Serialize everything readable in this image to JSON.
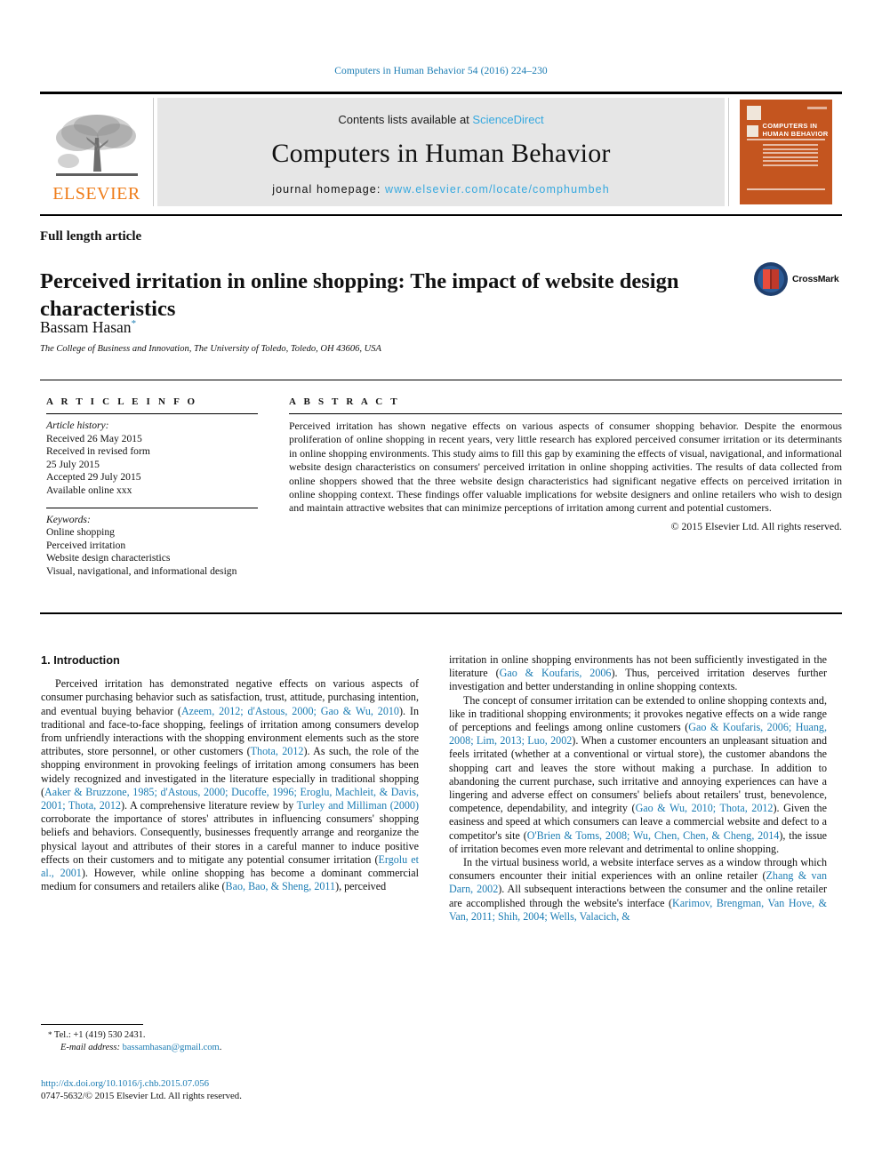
{
  "running_head": "Computers in Human Behavior 54 (2016) 224–230",
  "masthead": {
    "contents_prefix": "Contents lists available at ",
    "sciencedirect": "ScienceDirect",
    "journal_title": "Computers in Human Behavior",
    "homepage_label": "journal homepage:",
    "homepage_url": "www.elsevier.com/locate/comphumbeh",
    "publisher_wordmark": "ELSEVIER",
    "cover_title_line1": "COMPUTERS IN",
    "cover_title_line2": "HUMAN BEHAVIOR",
    "accent_blue": "#35a8df",
    "elsevier_orange": "#ef7d1a",
    "cover_orange": "#c4551f",
    "band_gray": "#e6e6e6"
  },
  "article": {
    "type": "Full length article",
    "title": "Perceived irritation in online shopping: The impact of website design characteristics",
    "author": "Bassam Hasan",
    "author_mark": "*",
    "affiliation": "The College of Business and Innovation, The University of Toledo, Toledo, OH 43606, USA",
    "crossmark_label": "CrossMark"
  },
  "article_info": {
    "heading": "A R T I C L E  I N F O",
    "history_label": "Article history:",
    "history": [
      "Received 26 May 2015",
      "Received in revised form",
      "25 July 2015",
      "Accepted 29 July 2015",
      "Available online xxx"
    ],
    "keywords_label": "Keywords:",
    "keywords": [
      "Online shopping",
      "Perceived irritation",
      "Website design characteristics",
      "Visual, navigational, and informational design"
    ]
  },
  "abstract": {
    "heading": "A B S T R A C T",
    "text": "Perceived irritation has shown negative effects on various aspects of consumer shopping behavior. Despite the enormous proliferation of online shopping in recent years, very little research has explored perceived consumer irritation or its determinants in online shopping environments. This study aims to fill this gap by examining the effects of visual, navigational, and informational website design characteristics on consumers' perceived irritation in online shopping activities. The results of data collected from online shoppers showed that the three website design characteristics had significant negative effects on perceived irritation in online shopping context. These findings offer valuable implications for website designers and online retailers who wish to design and maintain attractive websites that can minimize perceptions of irritation among current and potential customers.",
    "copyright": "© 2015 Elsevier Ltd. All rights reserved."
  },
  "body": {
    "section_title": "1. Introduction",
    "left_p1_a": "Perceived irritation has demonstrated negative effects on various aspects of consumer purchasing behavior such as satisfaction, trust, attitude, purchasing intention, and eventual buying behavior (",
    "left_p1_ref1": "Azeem, 2012; d'Astous, 2000; Gao & Wu, 2010",
    "left_p1_b": "). In traditional and face-to-face shopping, feelings of irritation among consumers develop from unfriendly interactions with the shopping environment elements such as the store attributes, store personnel, or other customers (",
    "left_p1_ref2": "Thota, 2012",
    "left_p1_c": "). As such, the role of the shopping environment in provoking feelings of irritation among consumers has been widely recognized and investigated in the literature especially in traditional shopping (",
    "left_p1_ref3": "Aaker & Bruzzone, 1985; d'Astous, 2000; Ducoffe, 1996; Eroglu, Machleit, & Davis, 2001; Thota, 2012",
    "left_p1_d": "). A comprehensive literature review by ",
    "left_p1_ref4": "Turley and Milliman (2000)",
    "left_p1_e": " corroborate the importance of stores' attributes in influencing consumers' shopping beliefs and behaviors. Consequently, businesses frequently arrange and reorganize the physical layout and attributes of their stores in a careful manner to induce positive effects on their customers and to mitigate any potential consumer irritation (",
    "left_p1_ref5": "Ergolu et al., 2001",
    "left_p1_f": "). However, while online shopping has become a dominant commercial medium for consumers and retailers alike (",
    "left_p1_ref6": "Bao, Bao, & Sheng, 2011",
    "left_p1_g": "), perceived",
    "right_p1_a": "irritation in online shopping environments has not been sufficiently investigated in the literature (",
    "right_p1_ref1": "Gao & Koufaris, 2006",
    "right_p1_b": "). Thus, perceived irritation deserves further investigation and better understanding in online shopping contexts.",
    "right_p2_a": "The concept of consumer irritation can be extended to online shopping contexts and, like in traditional shopping environments; it provokes negative effects on a wide range of perceptions and feelings among online customers (",
    "right_p2_ref1": "Gao & Koufaris, 2006; Huang, 2008; Lim, 2013; Luo, 2002",
    "right_p2_b": "). When a customer encounters an unpleasant situation and feels irritated (whether at a conventional or virtual store), the customer abandons the shopping cart and leaves the store without making a purchase. In addition to abandoning the current purchase, such irritative and annoying experiences can have a lingering and adverse effect on consumers' beliefs about retailers' trust, benevolence, competence, dependability, and integrity (",
    "right_p2_ref2": "Gao & Wu, 2010; Thota, 2012",
    "right_p2_c": "). Given the easiness and speed at which consumers can leave a commercial website and defect to a competitor's site (",
    "right_p2_ref3": "O'Brien & Toms, 2008; Wu, Chen, Chen, & Cheng, 2014",
    "right_p2_d": "), the issue of irritation becomes even more relevant and detrimental to online shopping.",
    "right_p3_a": "In the virtual business world, a website interface serves as a window through which consumers encounter their initial experiences with an online retailer (",
    "right_p3_ref1": "Zhang & van Darn, 2002",
    "right_p3_b": "). All subsequent interactions between the consumer and the online retailer are accomplished through the website's interface (",
    "right_p3_ref2": "Karimov, Brengman, Van Hove, & Van, 2011; Shih, 2004; Wells, Valacich, &"
  },
  "footer": {
    "tel_star": "*",
    "tel": " Tel.: +1 (419) 530 2431.",
    "email_label": "E-mail address:",
    "email": "bassamhasan@gmail.com",
    "email_trail": ".",
    "doi": "http://dx.doi.org/10.1016/j.chb.2015.07.056",
    "issn": "0747-5632/© 2015 Elsevier Ltd. All rights reserved."
  }
}
